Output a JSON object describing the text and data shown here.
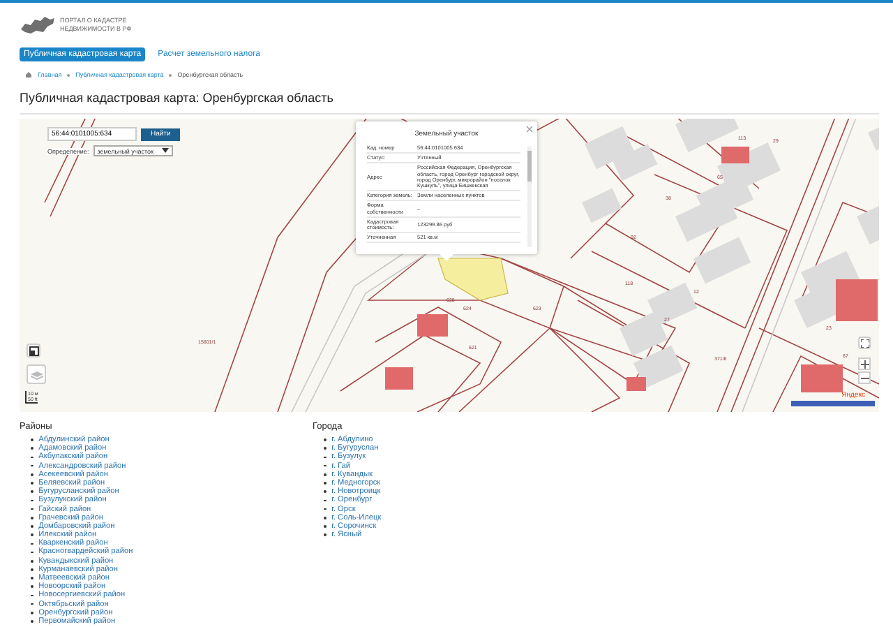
{
  "header": {
    "logo_line_1": "ПОРТАЛ О КАДАСТРЕ",
    "logo_line_2": "НЕДВИЖИМОСТИ В РФ"
  },
  "nav": [
    {
      "label": "Публичная кадастровая карта",
      "selected": true
    },
    {
      "label": "Расчет земельного налога",
      "selected": false
    }
  ],
  "breadcrumbs": [
    "Главная",
    "Публичная кадастровая карта",
    "Оренбургская область"
  ],
  "page_title": "Публичная кадастровая карта: Оренбургская область",
  "map": {
    "search": {
      "value": "56:44:0101005:634",
      "button": "Найти"
    },
    "definition": {
      "label": "Определение:",
      "value": "земельный участок"
    },
    "popup": {
      "title": "Земельный участок",
      "rows": [
        {
          "label": "Кад. номер",
          "value": "56:44:0101005:634"
        },
        {
          "label": "Статус:",
          "value": "Учтенный"
        },
        {
          "label": "Адрес",
          "value": "Российская Федерация, Оренбургская область, город Оренбург городской округ, город Оренбург, микрорайон \"поселок Кушкуль\", улица Бишкекская"
        },
        {
          "label": "Категория земель:",
          "value": "Земли населенных пунктов"
        },
        {
          "label": "Форма собственности",
          "value": "–"
        },
        {
          "label": "Кадастровая стоимость:",
          "value": "123299.86 руб"
        },
        {
          "label": "Уточненная",
          "value": "521 кв.м"
        }
      ]
    },
    "labels": [
      "15601/1",
      "628",
      "624",
      "623",
      "621",
      "113",
      "29",
      "65",
      "38",
      "92",
      "118",
      "12",
      "27",
      "23",
      "67",
      "371/8"
    ],
    "scale": [
      "10 м",
      "50 ft"
    ],
    "provider": "Яндекс"
  },
  "districts": {
    "title": "Районы",
    "items": [
      "Абдулинский район",
      "Адамовский район",
      "Акбулакский район",
      "Александровский район",
      "Асекеевский район",
      "Беляевский район",
      "Бугурусланский район",
      "Бузулукский район",
      "Гайский район",
      "Грачевский район",
      "Домбаровский район",
      "Илекский район",
      "Кваркенский район",
      "Красногвардейский район",
      "Кувандыкский район",
      "Курманаевский район",
      "Матвеевский район",
      "Новоорский район",
      "Новосергиевский район",
      "Октябрьский район",
      "Оренбургский район",
      "Первомайский район"
    ]
  },
  "cities": {
    "title": "Города",
    "items": [
      "г. Абдулино",
      "г. Бугуруслан",
      "г. Бузулук",
      "г. Гай",
      "г. Кувандык",
      "г. Медногорск",
      "г. Новотроицк",
      "г. Оренбург",
      "г. Орск",
      "г. Соль-Илецк",
      "г. Сорочинск",
      "г. Ясный"
    ]
  }
}
